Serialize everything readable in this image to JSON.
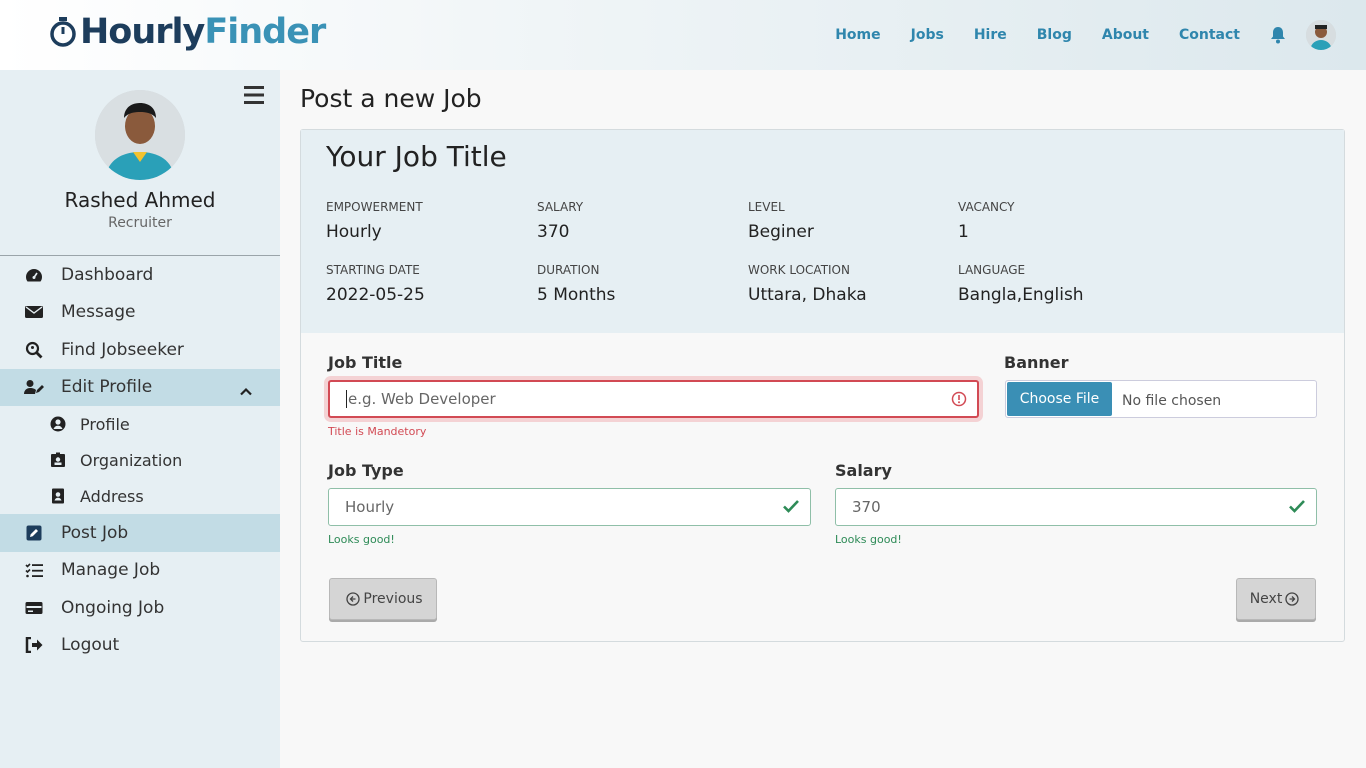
{
  "brand": {
    "part1": "Hourly",
    "part2": "Finder"
  },
  "nav": {
    "items": [
      "Home",
      "Jobs",
      "Hire",
      "Blog",
      "About",
      "Contact"
    ]
  },
  "user": {
    "name": "Rashed Ahmed",
    "role": "Recruiter"
  },
  "sidebar": {
    "items": [
      {
        "label": "Dashboard",
        "icon": "dashboard-icon"
      },
      {
        "label": "Message",
        "icon": "envelope-icon"
      },
      {
        "label": "Find Jobseeker",
        "icon": "search-icon"
      },
      {
        "label": "Edit Profile",
        "icon": "user-edit-icon"
      },
      {
        "label": "Profile",
        "icon": "user-circle-icon"
      },
      {
        "label": "Organization",
        "icon": "id-badge-icon"
      },
      {
        "label": "Address",
        "icon": "address-book-icon"
      },
      {
        "label": "Post Job",
        "icon": "edit-icon"
      },
      {
        "label": "Manage Job",
        "icon": "checklist-icon"
      },
      {
        "label": "Ongoing Job",
        "icon": "card-icon"
      },
      {
        "label": "Logout",
        "icon": "logout-icon"
      }
    ]
  },
  "page": {
    "title": "Post a new Job"
  },
  "summary": {
    "title": "Your Job Title",
    "fields": [
      {
        "label": "Empowerment",
        "value": "Hourly"
      },
      {
        "label": "Salary",
        "value": "370"
      },
      {
        "label": "Level",
        "value": "Beginer"
      },
      {
        "label": "Vacancy",
        "value": "1"
      },
      {
        "label": "Starting Date",
        "value": "2022-05-25"
      },
      {
        "label": "Duration",
        "value": "5 Months"
      },
      {
        "label": "Work Location",
        "value": "Uttara, Dhaka"
      },
      {
        "label": "Language",
        "value": "Bangla,English"
      }
    ]
  },
  "form": {
    "job_title": {
      "label": "Job Title",
      "placeholder": "e.g. Web Developer",
      "error": "Title is Mandetory"
    },
    "banner": {
      "label": "Banner",
      "button": "Choose File",
      "status": "No file chosen"
    },
    "job_type": {
      "label": "Job Type",
      "value": "Hourly",
      "feedback": "Looks good!"
    },
    "salary": {
      "label": "Salary",
      "value": "370",
      "feedback": "Looks good!"
    },
    "previous_label": "Previous",
    "next_label": "Next"
  },
  "colors": {
    "primary": "#3a8fb5",
    "dark": "#1d3d5c",
    "error": "#d24a54",
    "success": "#2e8b57"
  }
}
